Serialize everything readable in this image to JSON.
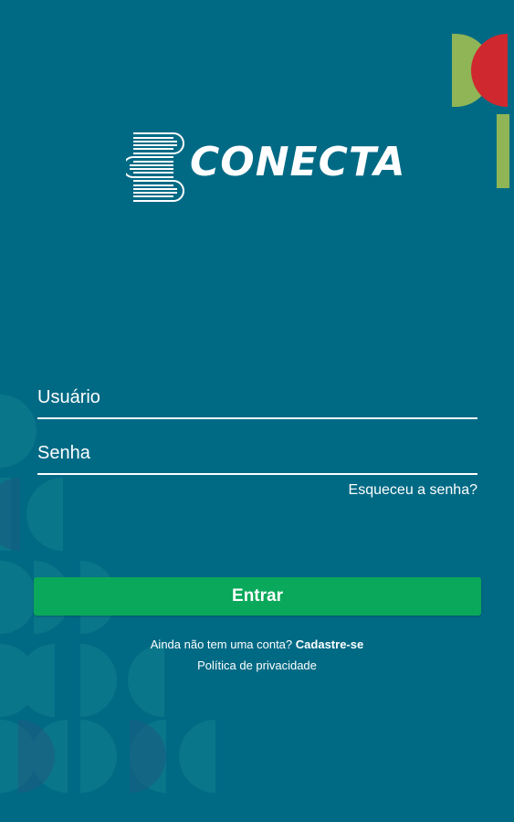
{
  "colors": {
    "background": "#006a85",
    "button": "#0aa85a",
    "text": "#ffffff",
    "accent_green": "#8fb556",
    "accent_red": "#d0282f"
  },
  "logo": {
    "text": "CONECTA",
    "icon": "stacked-books-icon"
  },
  "login_form": {
    "username_placeholder": "Usuário",
    "password_placeholder": "Senha",
    "forgot_password": "Esqueceu a senha?",
    "submit_label": "Entrar"
  },
  "footer": {
    "signup_prompt": "Ainda não tem uma conta?",
    "signup_link": "Cadastre-se",
    "privacy_policy": "Política de privacidade"
  }
}
